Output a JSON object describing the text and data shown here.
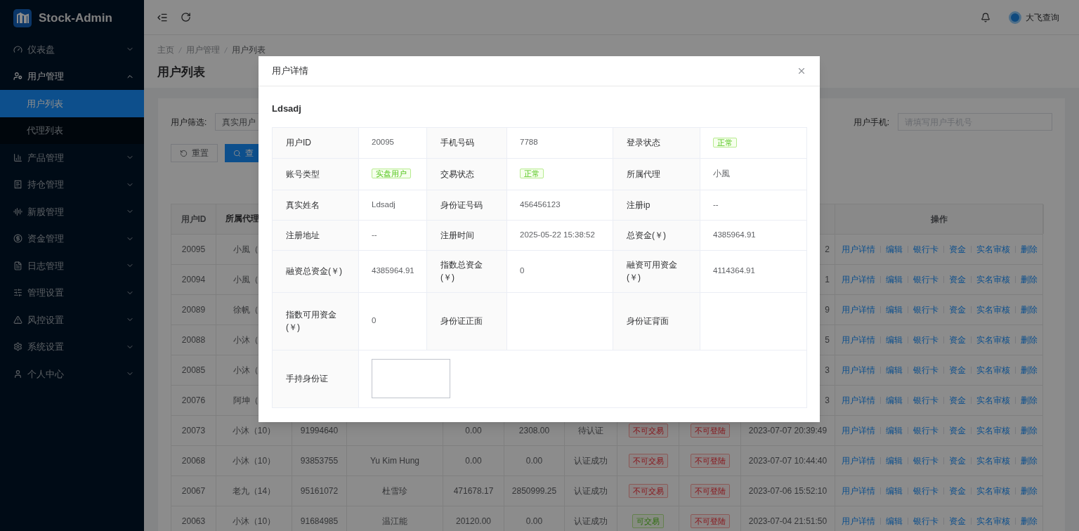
{
  "sidebar": {
    "logo": "Stock-Admin",
    "items": [
      {
        "label": "仪表盘",
        "expanded": false
      },
      {
        "label": "用户管理",
        "expanded": true,
        "children": [
          {
            "label": "用户列表",
            "selected": true
          },
          {
            "label": "代理列表",
            "selected": false
          }
        ]
      },
      {
        "label": "产品管理",
        "expanded": false
      },
      {
        "label": "持仓管理",
        "expanded": false
      },
      {
        "label": "新股管理",
        "expanded": false
      },
      {
        "label": "资金管理",
        "expanded": false
      },
      {
        "label": "日志管理",
        "expanded": false
      },
      {
        "label": "管理设置",
        "expanded": false
      },
      {
        "label": "风控设置",
        "expanded": false
      },
      {
        "label": "系统设置",
        "expanded": false
      },
      {
        "label": "个人中心",
        "expanded": false
      }
    ]
  },
  "header": {
    "user": "大飞查询"
  },
  "breadcrumb": [
    "主页",
    "用户管理",
    "用户列表"
  ],
  "page_title": "用户列表",
  "filters": {
    "user_filter": {
      "label": "用户筛选:",
      "value": "真实用户"
    },
    "phone": {
      "label": "用户手机:",
      "placeholder": "请填写用户手机号"
    },
    "buttons": [
      "重置",
      "查"
    ]
  },
  "table": {
    "columns": [
      "用户ID",
      "所属代理",
      "操作"
    ],
    "rows": [
      {
        "id": "20095",
        "agent": "小風（",
        "time": "2",
        "actions": [
          "用户详情",
          "编辑",
          "银行卡",
          "资金",
          "实名审核",
          "删除"
        ]
      },
      {
        "id": "20094",
        "agent": "小風（",
        "time": "1",
        "actions": [
          "用户详情",
          "编辑",
          "银行卡",
          "资金",
          "实名审核",
          "删除"
        ]
      },
      {
        "id": "20089",
        "agent": "徐帆（",
        "time": "9",
        "actions": [
          "用户详情",
          "编辑",
          "银行卡",
          "资金",
          "实名审核",
          "删除"
        ]
      },
      {
        "id": "20088",
        "agent": "小沐（",
        "time": "5",
        "actions": [
          "用户详情",
          "编辑",
          "银行卡",
          "资金",
          "实名审核",
          "删除"
        ]
      },
      {
        "id": "20085",
        "agent": "小沐（",
        "time": "3",
        "actions": [
          "用户详情",
          "编辑",
          "银行卡",
          "资金",
          "实名审核",
          "删除"
        ]
      },
      {
        "id": "20076",
        "agent": "阿坤（",
        "time": "3",
        "actions": [
          "用户详情",
          "编辑",
          "银行卡",
          "资金",
          "实名审核",
          "删除"
        ]
      },
      {
        "id": "20073",
        "agent": "小沐（10）",
        "phone": "91994640",
        "c5": "0.00",
        "c6": "2308.00",
        "auth": "待认证",
        "trade": {
          "label": "不可交易",
          "allowed": false
        },
        "login": {
          "label": "不可登陆",
          "allowed": false
        },
        "time": "2023-07-07 20:39:49",
        "actions": [
          "用户详情",
          "编辑",
          "银行卡",
          "资金",
          "实名审核",
          "删除"
        ]
      },
      {
        "id": "20068",
        "agent": "小沐（10）",
        "phone": "93853755",
        "name": "Yu Kim Hung",
        "c5": "0.00",
        "c6": "0.00",
        "auth": "认证成功",
        "trade": {
          "label": "不可交易",
          "allowed": false
        },
        "login": {
          "label": "不可登陆",
          "allowed": false
        },
        "time": "2023-07-07 10:44:40",
        "actions": [
          "用户详情",
          "编辑",
          "银行卡",
          "资金",
          "实名审核",
          "删除"
        ]
      },
      {
        "id": "20067",
        "agent": "老九（14）",
        "phone": "95161072",
        "name": "杜雪珍",
        "c5": "471678.17",
        "c6": "2850999.25",
        "auth": "认证成功",
        "trade": {
          "label": "不可交易",
          "allowed": false
        },
        "login": {
          "label": "不可登陆",
          "allowed": false
        },
        "time": "2023-07-06 15:52:10",
        "actions": [
          "用户详情",
          "编辑",
          "银行卡",
          "资金",
          "实名审核",
          "删除"
        ]
      },
      {
        "id": "20063",
        "agent": "小沐（10）",
        "phone": "91684985",
        "name": "温江能",
        "c5": "20120.00",
        "c6": "0.00",
        "auth": "认证成功",
        "trade": {
          "label": "可交易",
          "allowed": true
        },
        "login": {
          "label": "不可登陆",
          "allowed": false
        },
        "time": "2023-07-04 21:51:50",
        "actions": [
          "用户详情",
          "编辑",
          "银行卡",
          "资金",
          "实名审核",
          "删除"
        ]
      }
    ]
  },
  "dialog": {
    "title": "用户详情",
    "name": "Ldsadj",
    "rows": [
      {
        "cells": [
          {
            "label": "用户ID",
            "kind": "text",
            "value": "20095"
          },
          {
            "label": "手机号码",
            "kind": "text",
            "value": "7788"
          },
          {
            "label": "登录状态",
            "kind": "tag",
            "value": "正常"
          }
        ]
      },
      {
        "cells": [
          {
            "label": "账号类型",
            "kind": "tag",
            "value": "实盘用户"
          },
          {
            "label": "交易状态",
            "kind": "tag",
            "value": "正常"
          },
          {
            "label": "所属代理",
            "kind": "text",
            "value": "小風"
          }
        ]
      },
      {
        "cells": [
          {
            "label": "真实姓名",
            "kind": "text",
            "value": "Ldsadj"
          },
          {
            "label": "身份证号码",
            "kind": "text",
            "value": "456456123"
          },
          {
            "label": "注册ip",
            "kind": "text",
            "value": "--"
          }
        ]
      },
      {
        "cells": [
          {
            "label": "注册地址",
            "kind": "text",
            "value": "--"
          },
          {
            "label": "注册时间",
            "kind": "text",
            "value": "2025-05-22 15:38:52"
          },
          {
            "label": "总资金(￥)",
            "kind": "text",
            "value": "4385964.91"
          }
        ]
      },
      {
        "cells": [
          {
            "label": "融资总资金(￥)",
            "kind": "text",
            "value": "4385964.91"
          },
          {
            "label": "指数总资金(￥)",
            "kind": "text",
            "value": "0"
          },
          {
            "label": "融资可用资金(￥)",
            "kind": "text",
            "value": "4114364.91"
          }
        ]
      },
      {
        "cells": [
          {
            "label": "指数可用资金(￥)",
            "kind": "text",
            "value": "0"
          },
          {
            "label": "身份证正面",
            "kind": "text"
          },
          {
            "label": "身份证背面",
            "kind": "text"
          }
        ]
      },
      {
        "cells": [
          {
            "label": "手持身份证",
            "kind": "image"
          }
        ]
      }
    ]
  }
}
